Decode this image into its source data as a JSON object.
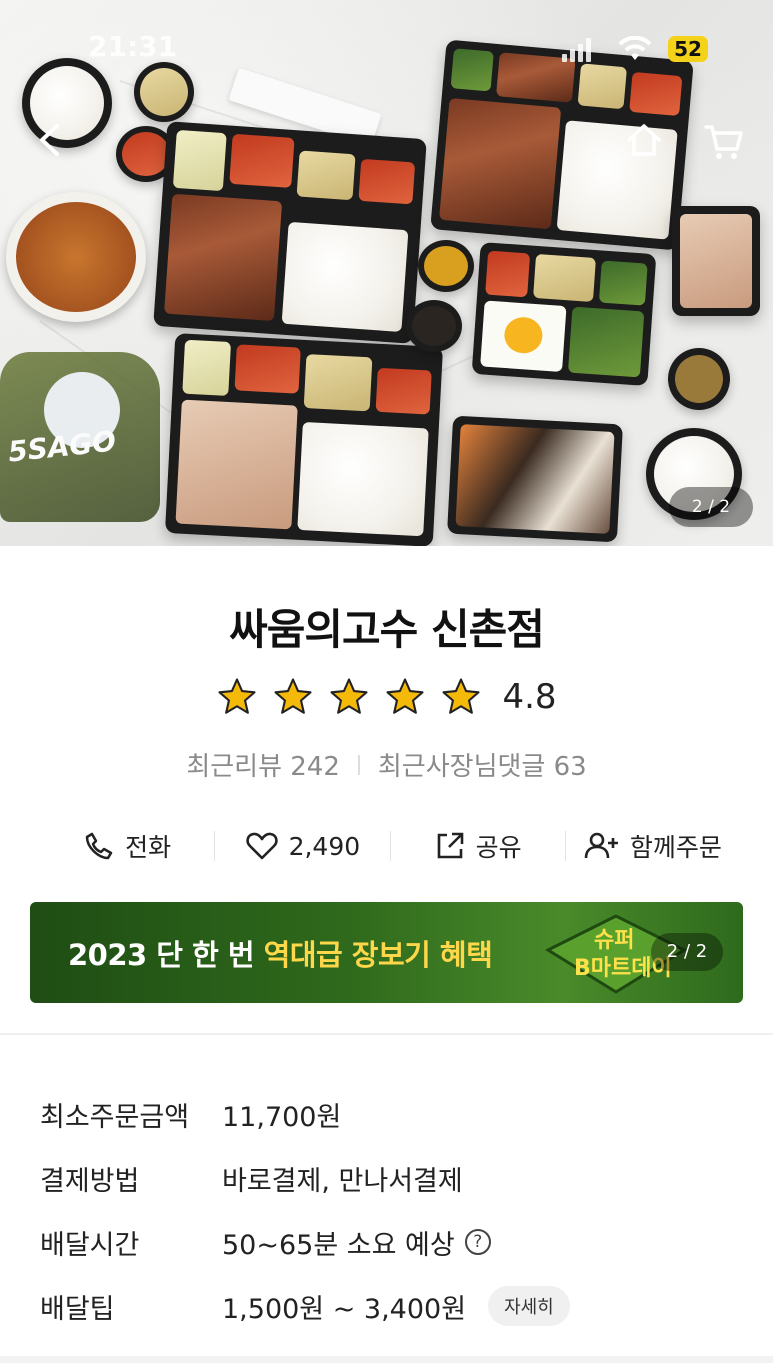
{
  "status_bar": {
    "time": "21:31",
    "battery": "52"
  },
  "hero": {
    "page_indicator": "2 / 2",
    "back_icon": "back-arrow-icon",
    "home_icon": "home-icon",
    "cart_icon": "cart-icon",
    "brand_text": "5SAGO"
  },
  "store": {
    "name": "싸움의고수 신촌점",
    "rating": "4.8",
    "stars": 5,
    "recent_reviews": "최근리뷰 242",
    "owner_replies": "최근사장님댓글 63"
  },
  "actions": [
    {
      "icon": "phone-icon",
      "label": "전화"
    },
    {
      "icon": "heart-icon",
      "label": "2,490"
    },
    {
      "icon": "share-icon",
      "label": "공유"
    },
    {
      "icon": "add-person-icon",
      "label": "함께주문"
    }
  ],
  "banner": {
    "text_prefix": "2023 단 한 번 ",
    "text_highlight": "역대급 장보기 혜택",
    "badge_line1": "슈퍼",
    "badge_line2": "B마트데이",
    "page_indicator": "2 / 2"
  },
  "details": [
    {
      "label": "최소주문금액",
      "value": "11,700원"
    },
    {
      "label": "결제방법",
      "value": "바로결제, 만나서결제"
    },
    {
      "label": "배달시간",
      "value": "50~65분 소요 예상"
    },
    {
      "label": "배달팁",
      "value": "1,500원 ~ 3,400원",
      "button": "자세히"
    }
  ],
  "colors": {
    "star": "#f5b90a",
    "banner_green": "#2f6a1c",
    "banner_highlight": "#ffd84a",
    "battery": "#f5d21a"
  }
}
